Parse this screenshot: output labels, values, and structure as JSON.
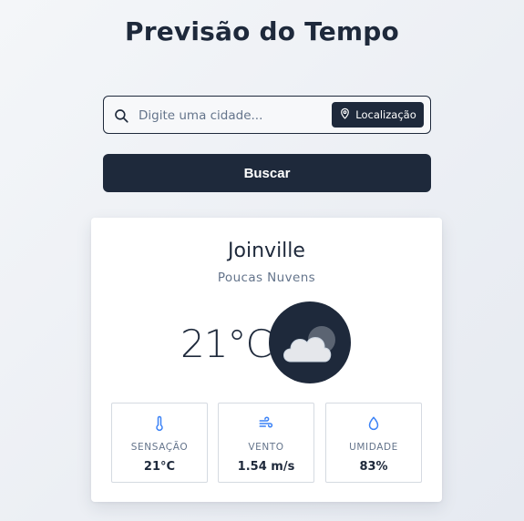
{
  "page": {
    "title": "Previsão do Tempo"
  },
  "search": {
    "placeholder": "Digite uma cidade...",
    "value": "",
    "location_label": "Localização",
    "submit_label": "Buscar",
    "icon": "search-icon",
    "location_icon": "map-pin-icon"
  },
  "weather": {
    "city": "Joinville",
    "description": "Poucas Nuvens",
    "temperature": "21°C",
    "icon": "cloudy-night-icon",
    "stats": [
      {
        "label": "SENSAÇÃO",
        "value": "21°C",
        "icon": "thermometer-icon"
      },
      {
        "label": "VENTO",
        "value": "1.54 m/s",
        "icon": "wind-icon"
      },
      {
        "label": "UMIDADE",
        "value": "83%",
        "icon": "droplet-icon"
      }
    ]
  },
  "colors": {
    "primary": "#1e293b",
    "accent_icon": "#3b82f6",
    "muted_text": "#64748b",
    "card_border": "#d5dae1"
  }
}
